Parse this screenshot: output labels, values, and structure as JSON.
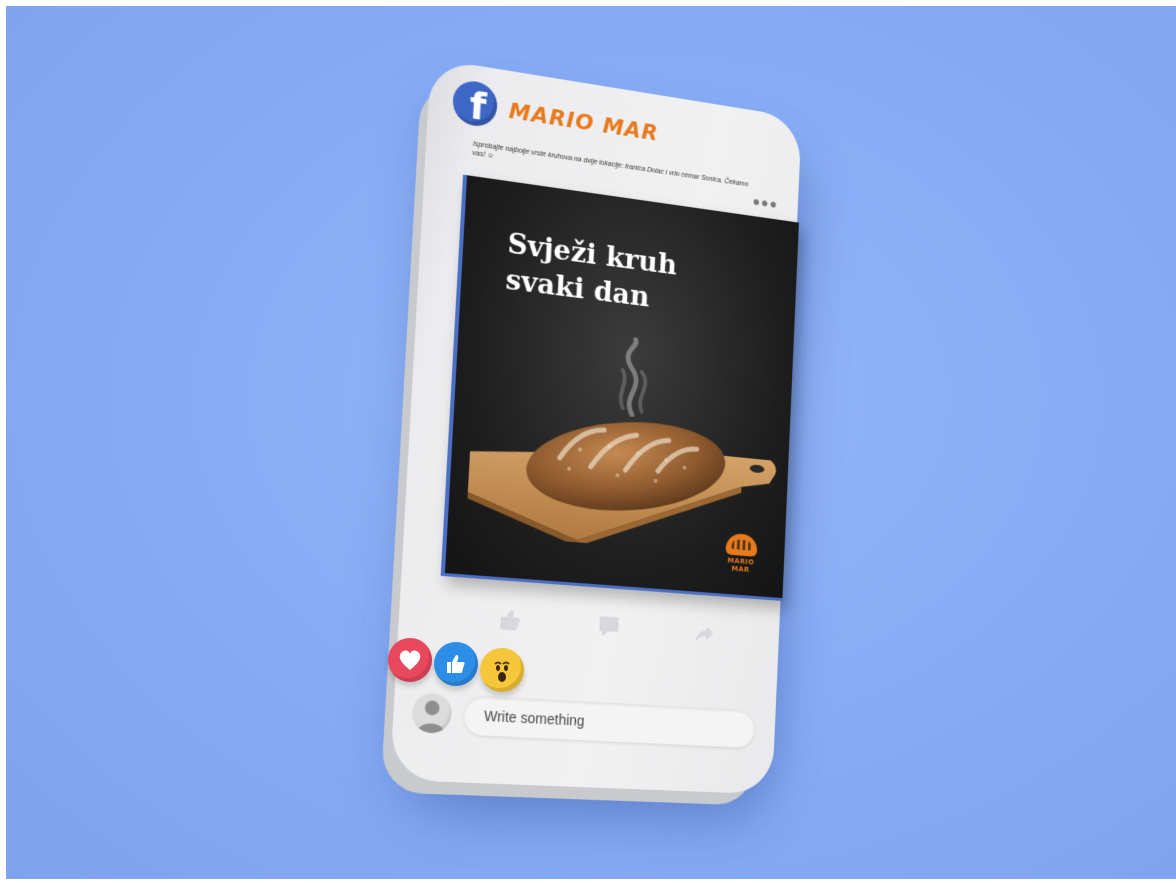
{
  "page": {
    "background_color": "#8ab0f8"
  },
  "post": {
    "brand_name": "MARIO MAR",
    "caption": "Isprobajte najbolje vrste kruhova na dvije lokacije: tranica Dolac i vrlo cemar Sonica. Čekamo vas! ☺",
    "more_icon": "more-dots-icon",
    "image": {
      "headline_line1": "Svježi kruh",
      "headline_line2": "svaki dan",
      "logo_text": "MARIO MAR"
    },
    "actions": [
      {
        "icon": "like-icon"
      },
      {
        "icon": "comment-icon"
      },
      {
        "icon": "share-icon"
      }
    ],
    "reactions": [
      {
        "icon": "heart-reaction-icon",
        "color": "#e8485d"
      },
      {
        "icon": "like-reaction-icon",
        "color": "#2c8ee6"
      },
      {
        "icon": "wow-reaction-icon",
        "color": "#f6c73a"
      }
    ],
    "comment": {
      "placeholder": "Write something"
    }
  },
  "colors": {
    "brand_orange": "#e87a1e",
    "facebook_blue": "#3d67c7"
  }
}
